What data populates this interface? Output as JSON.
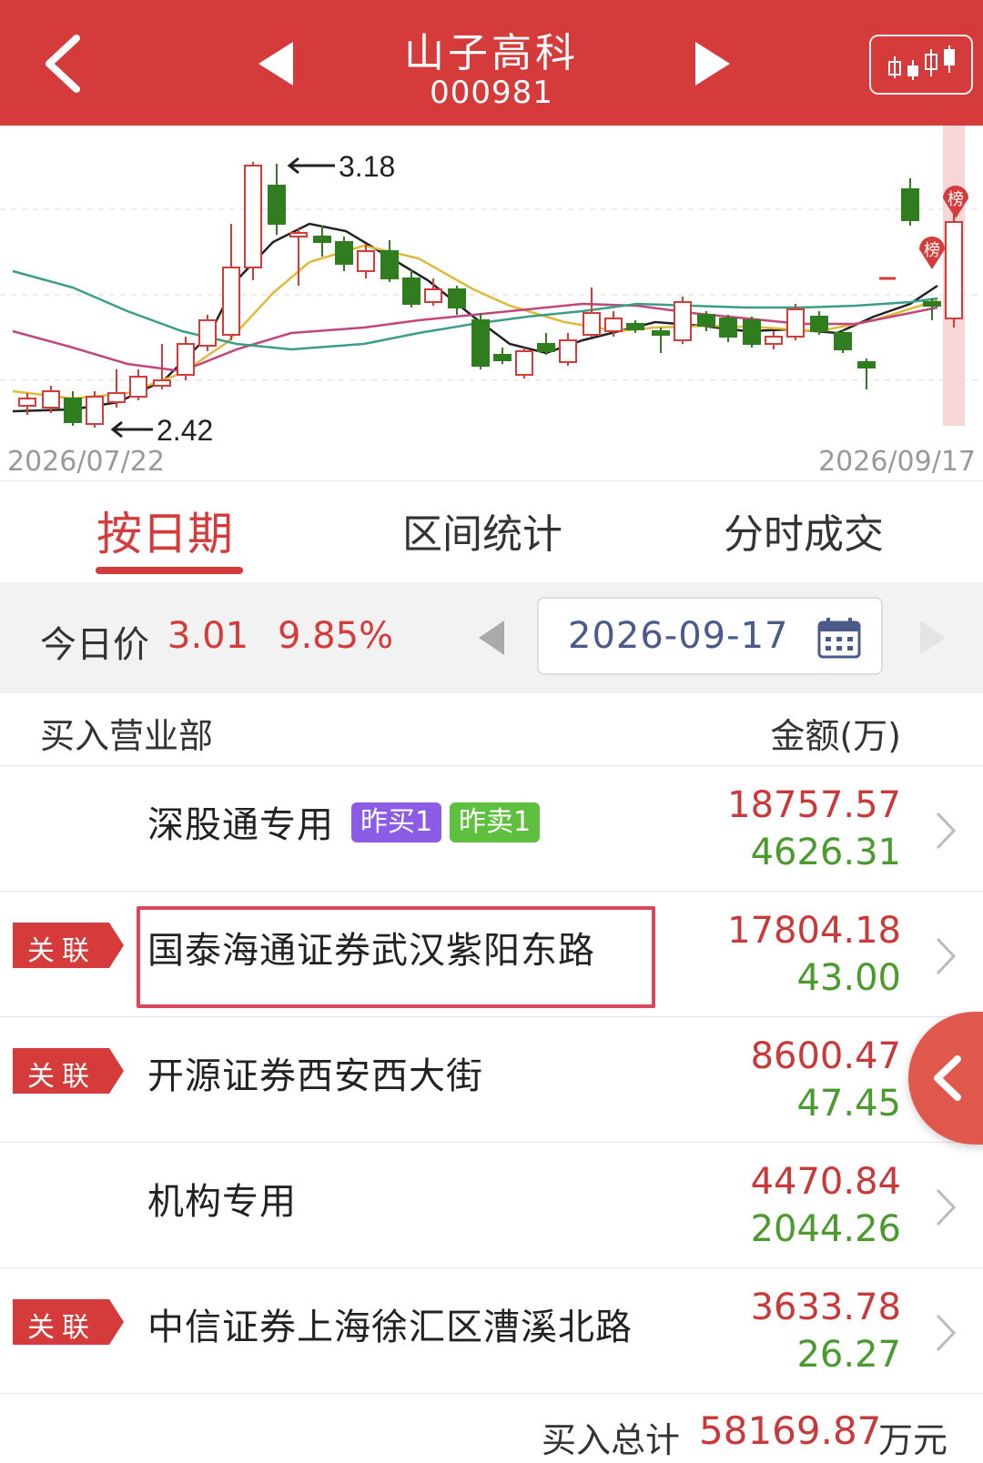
{
  "header": {
    "title": "山子高科",
    "code": "000981"
  },
  "chart": {
    "high_label": "3.18",
    "low_label": "2.42",
    "start_date": "2026/07/22",
    "end_date": "2026/09/17",
    "bang_label": "榜",
    "colors": {
      "up": "#d63b3b",
      "down": "#2f7d1e"
    }
  },
  "tabs": [
    {
      "label": "按日期",
      "active": true
    },
    {
      "label": "区间统计",
      "active": false
    },
    {
      "label": "分时成交",
      "active": false
    }
  ],
  "price_bar": {
    "label": "今日价",
    "price": "3.01",
    "change_pct": "9.85%",
    "date": "2026-09-17"
  },
  "table": {
    "left_header": "买入营业部",
    "right_header": "金额(万)",
    "assoc_label": "关联",
    "rows": [
      {
        "name": "深股通专用",
        "buy": "18757.57",
        "sell": "4626.31",
        "tags": [
          "昨买1",
          "昨卖1"
        ],
        "assoc": false
      },
      {
        "name": "国泰海通证券武汉紫阳东路",
        "buy": "17804.18",
        "sell": "43.00",
        "tags": [],
        "assoc": true
      },
      {
        "name": "开源证券西安西大街",
        "buy": "8600.47",
        "sell": "47.45",
        "tags": [],
        "assoc": true
      },
      {
        "name": "机构专用",
        "buy": "4470.84",
        "sell": "2044.26",
        "tags": [],
        "assoc": false
      },
      {
        "name": "中信证券上海徐汇区漕溪北路",
        "buy": "3633.78",
        "sell": "26.27",
        "tags": [],
        "assoc": true
      }
    ]
  },
  "footer": {
    "label": "买入总计",
    "total": "58169.87",
    "unit": "万元"
  }
}
